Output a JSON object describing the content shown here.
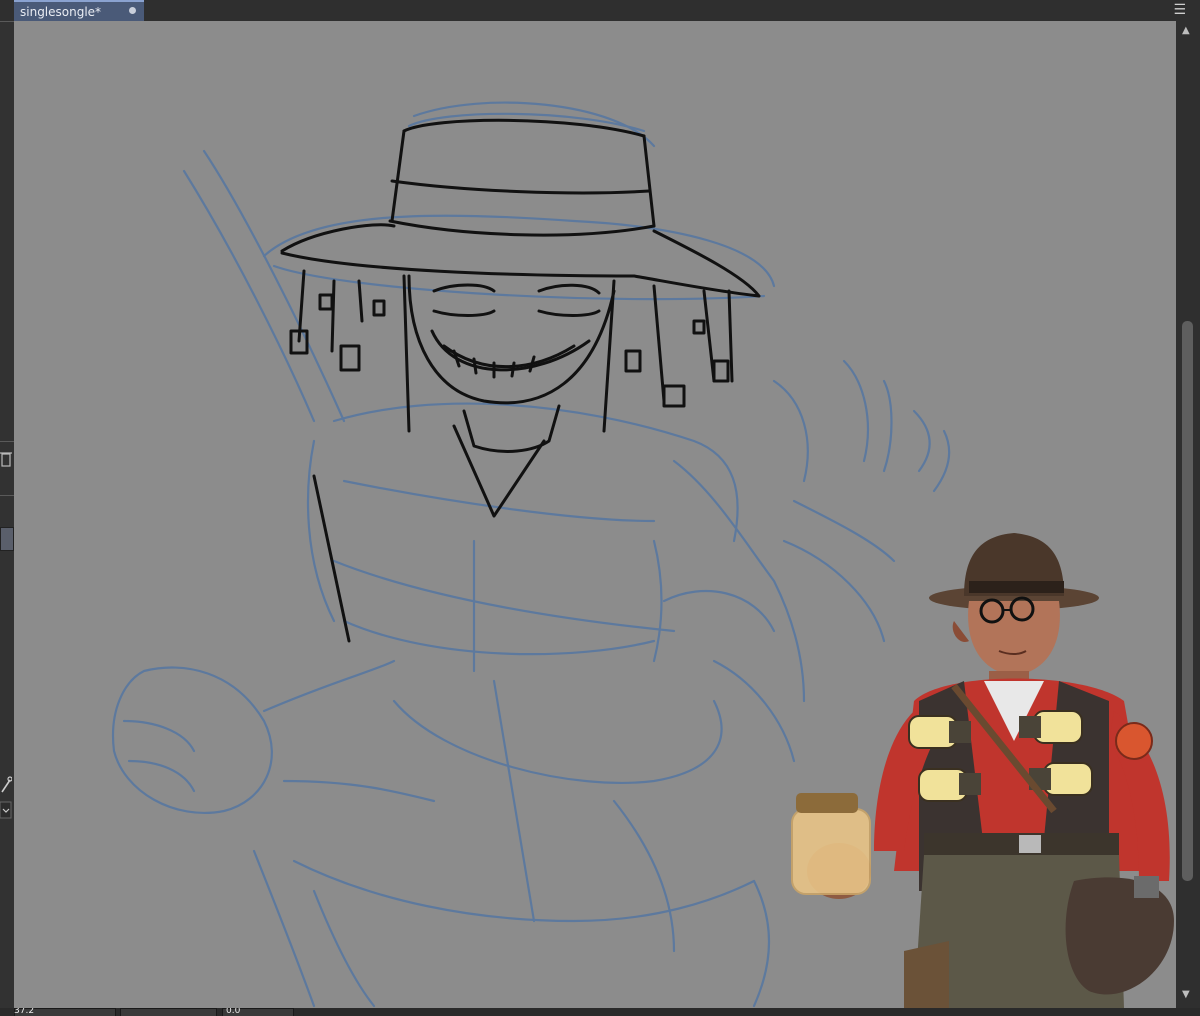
{
  "document_tab": {
    "title": "singlesongle*"
  },
  "window_menu_icon": "hamburger-menu-icon",
  "status": {
    "zoom": "37.2",
    "rotation": "0.0"
  },
  "colors": {
    "canvas": "#8c8c8c",
    "sketch_blue": "#5878a0",
    "lineart": "#111111",
    "tab_accent": "#4a5a78"
  },
  "icons": [
    "trash-icon",
    "lock-icon",
    "eyedropper-icon",
    "chevron-down-icon",
    "close-dot-icon"
  ]
}
